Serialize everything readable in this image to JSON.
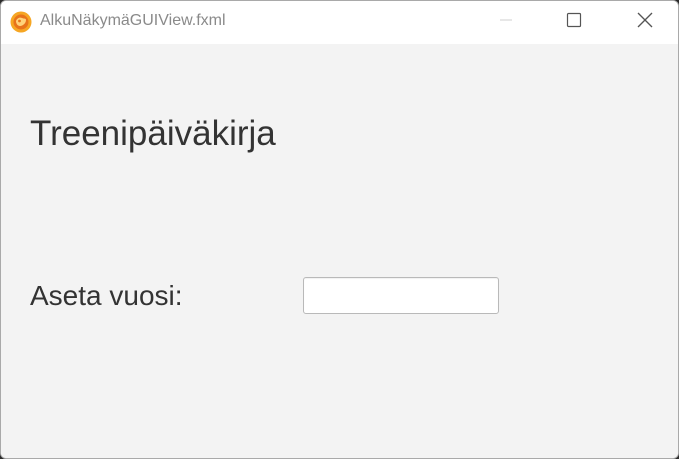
{
  "window": {
    "title": "AlkuNäkymäGUIView.fxml",
    "app_icon": "java-fx-app-icon",
    "controls": {
      "minimize_icon": "minimize-icon",
      "maximize_icon": "maximize-icon",
      "close_icon": "close-icon"
    }
  },
  "main": {
    "heading": "Treenipäiväkirja",
    "year_label": "Aseta vuosi:",
    "year_input": {
      "value": "",
      "placeholder": ""
    }
  },
  "colors": {
    "titlebar_bg": "#ffffff",
    "content_bg": "#f3f3f3",
    "text": "#333333",
    "title_text": "#8a8a8a",
    "icon_accent": "#f29a1d"
  }
}
